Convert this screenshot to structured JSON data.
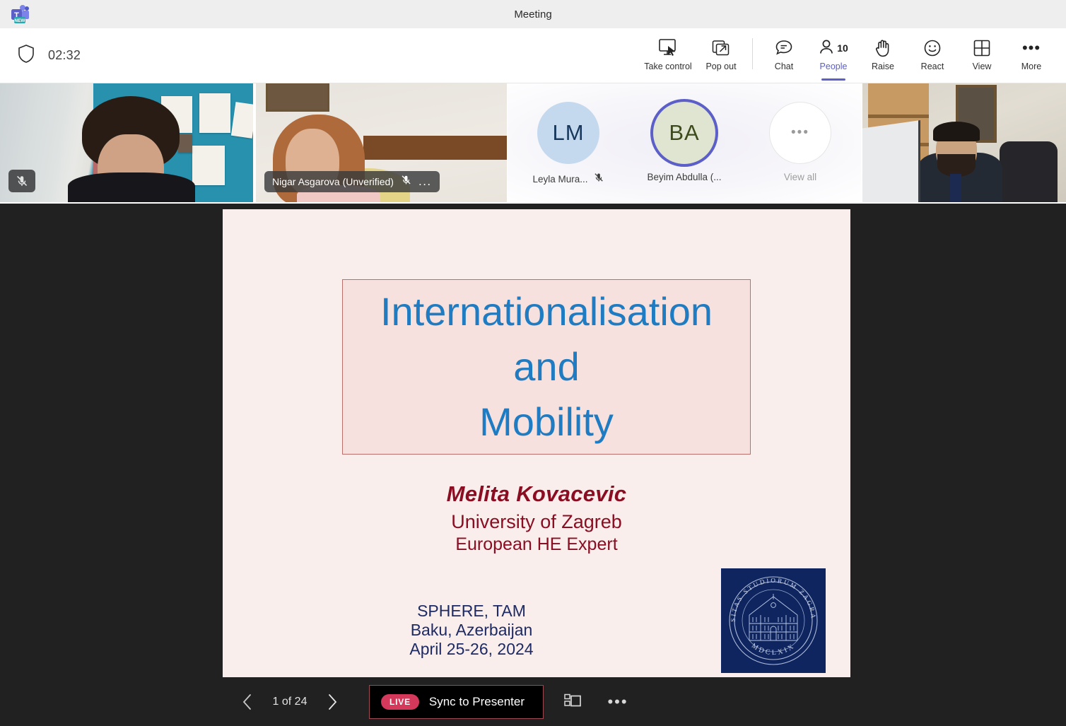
{
  "window": {
    "title": "Meeting",
    "app_icon": "microsoft-teams-logo",
    "badge": "NEW"
  },
  "toolbar": {
    "shield_icon": "shield-icon",
    "timer": "02:32",
    "buttons": [
      {
        "label": "Take control",
        "icon": "take-control-icon",
        "name": "take-control-button"
      },
      {
        "label": "Pop out",
        "icon": "pop-out-icon",
        "name": "pop-out-button"
      },
      {
        "label": "Chat",
        "icon": "chat-icon",
        "name": "chat-button"
      },
      {
        "label": "People",
        "icon": "people-icon",
        "name": "people-button",
        "count": "10",
        "active": true
      },
      {
        "label": "Raise",
        "icon": "raise-hand-icon",
        "name": "raise-hand-button"
      },
      {
        "label": "React",
        "icon": "react-smiley-icon",
        "name": "react-button"
      },
      {
        "label": "View",
        "icon": "view-grid-icon",
        "name": "view-button"
      },
      {
        "label": "More",
        "icon": "more-dots-icon",
        "name": "more-button"
      }
    ],
    "accent_color": "#5b5fc7"
  },
  "video_strip": {
    "tiles": [
      {
        "name": "",
        "muted": true,
        "has_name_pill": false
      },
      {
        "name": "Nigar Asgarova (Unverified)",
        "muted": true,
        "has_name_pill": true,
        "overflow": "..."
      },
      {
        "name": "",
        "muted": false,
        "has_name_pill": false
      }
    ],
    "avatars": [
      {
        "initials": "LM",
        "name": "Leyla Mura...",
        "muted": true,
        "speaking": false,
        "bg": "#c5d9ee"
      },
      {
        "initials": "BA",
        "name": "Beyim Abdulla (...",
        "muted": false,
        "speaking": true,
        "bg": "#dfe5d1"
      }
    ],
    "view_all": {
      "label": "View all",
      "icon": "ellipsis-icon"
    }
  },
  "slide": {
    "title_lines": [
      "Internationalisation",
      "and",
      "Mobility"
    ],
    "title_color": "#1f7cc2",
    "box_border_color": "#b9706a",
    "background": "#faeeec",
    "author": {
      "name": "Melita Kovacevic",
      "affiliation": "University of Zagreb",
      "role": "European HE Expert",
      "color": "#8b0d22"
    },
    "event": {
      "lines": [
        "SPHERE, TAM",
        "Baku, Azerbaijan",
        "April 25-26, 2024"
      ],
      "color": "#1d2a63"
    },
    "logo": {
      "name": "university-of-zagreb-seal",
      "outer_text": "UNIVERSITAS STUDIORUM ZAGRABIENSIS",
      "year": "MDCLXIX",
      "background": "#0f2560"
    }
  },
  "slide_controls": {
    "previous_icon": "chevron-left-icon",
    "next_icon": "chevron-right-icon",
    "page_indicator": "1 of 24",
    "live_badge": "LIVE",
    "sync_label": "Sync to Presenter",
    "thumbnails_icon": "slide-thumbnails-icon",
    "more_icon": "more-dots-icon",
    "live_color": "#d4385a"
  }
}
